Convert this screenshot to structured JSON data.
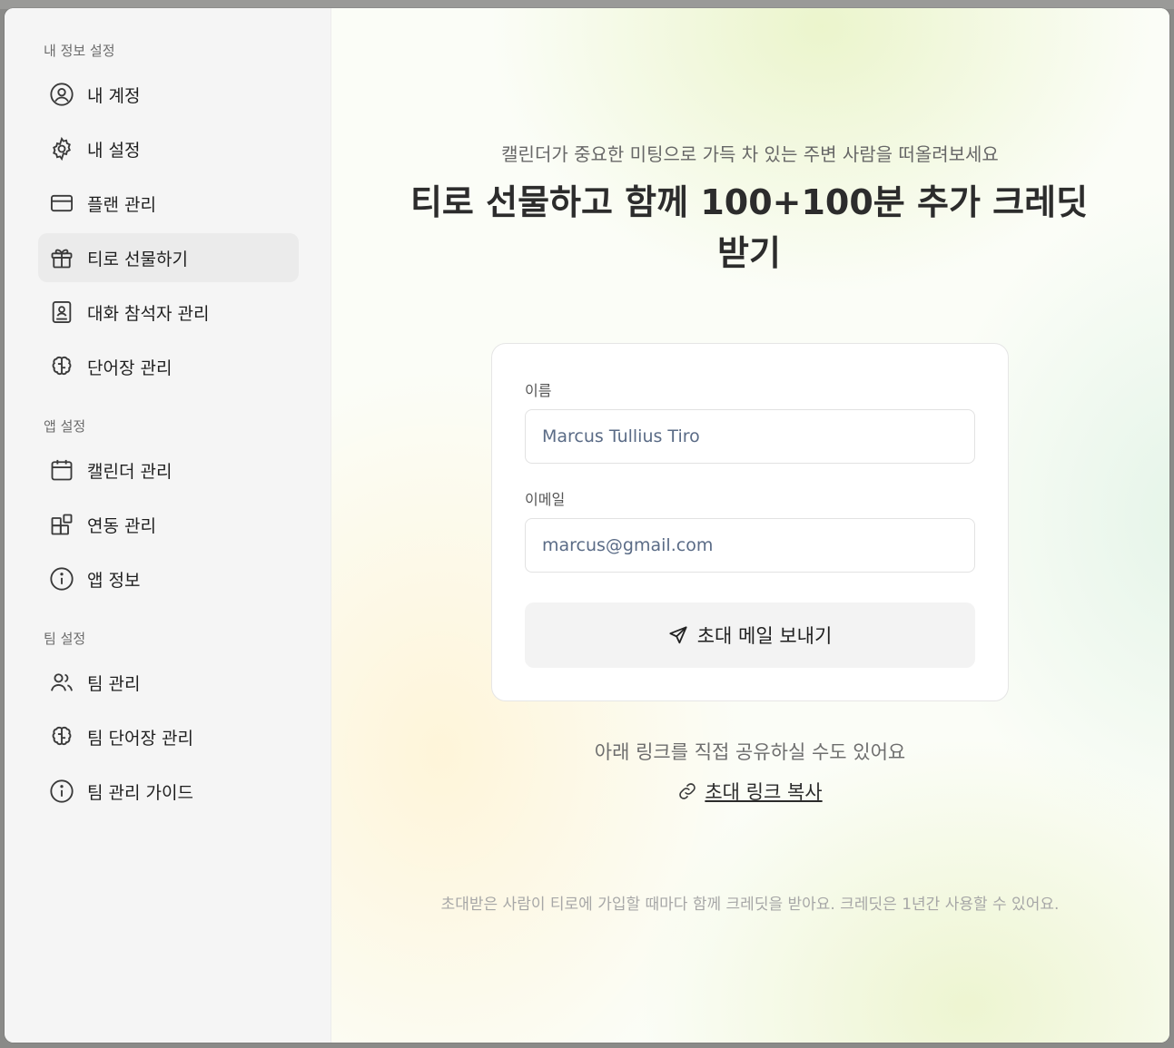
{
  "sidebar": {
    "sections": [
      {
        "label": "내 정보 설정",
        "items": [
          {
            "label": "내 계정",
            "icon": "user-circle-icon"
          },
          {
            "label": "내 설정",
            "icon": "gear-icon"
          },
          {
            "label": "플랜 관리",
            "icon": "credit-card-icon"
          },
          {
            "label": "티로 선물하기",
            "icon": "gift-icon",
            "active": true
          },
          {
            "label": "대화 참석자 관리",
            "icon": "contact-book-icon"
          },
          {
            "label": "단어장 관리",
            "icon": "brain-icon"
          }
        ]
      },
      {
        "label": "앱 설정",
        "items": [
          {
            "label": "캘린더 관리",
            "icon": "calendar-icon"
          },
          {
            "label": "연동 관리",
            "icon": "integration-blocks-icon"
          },
          {
            "label": "앱 정보",
            "icon": "info-icon"
          }
        ]
      },
      {
        "label": "팀 설정",
        "items": [
          {
            "label": "팀 관리",
            "icon": "users-icon"
          },
          {
            "label": "팀 단어장 관리",
            "icon": "brain-icon"
          },
          {
            "label": "팀 관리 가이드",
            "icon": "info-icon"
          }
        ]
      }
    ]
  },
  "main": {
    "subtitle": "캘린더가 중요한 미팅으로 가득 차 있는 주변 사람을 떠올려보세요",
    "headline": "티로 선물하고 함께 100+100분 추가 크레딧 받기",
    "form": {
      "name_label": "이름",
      "name_value": "Marcus Tullius Tiro",
      "email_label": "이메일",
      "email_value": "marcus@gmail.com",
      "send_label": "초대 메일 보내기"
    },
    "share_text": "아래 링크를 직접 공유하실 수도 있어요",
    "copy_link_label": "초대 링크 복사",
    "footnote": "초대받은 사람이 티로에 가입할 때마다 함께 크레딧을 받아요. 크레딧은 1년간 사용할 수 있어요."
  },
  "colors": {
    "sidebar_bg": "#f5f5f5",
    "active_item_bg": "#ebebeb",
    "input_text": "#5a6b86",
    "button_bg": "#f3f3f3"
  }
}
